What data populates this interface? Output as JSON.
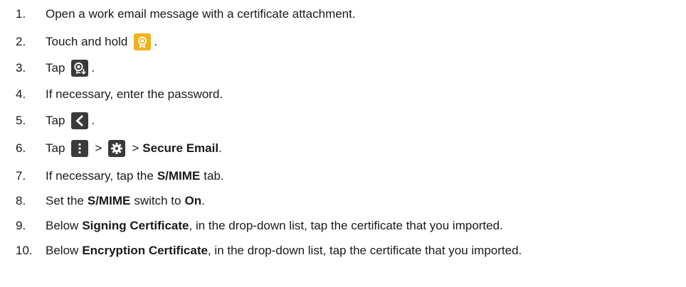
{
  "steps": [
    {
      "num": "1.",
      "text": "Open a work email message with a certificate attachment."
    },
    {
      "num": "2.",
      "pre": "Touch and hold",
      "post": ".",
      "icon": "certificate-icon"
    },
    {
      "num": "3.",
      "pre": "Tap",
      "post": ".",
      "icon": "import-certificate-icon"
    },
    {
      "num": "4.",
      "text": "If necessary, enter the password."
    },
    {
      "num": "5.",
      "pre": "Tap",
      "post": ".",
      "icon": "back-arrow-icon"
    },
    {
      "num": "6.",
      "pre": "Tap",
      "sep1": ">",
      "sep2": ">",
      "bold": "Secure Email",
      "post": ".",
      "icon1": "menu-more-icon",
      "icon2": "settings-gear-icon"
    },
    {
      "num": "7.",
      "pre": "If necessary, tap the",
      "bold": "S/MIME",
      "post": "tab."
    },
    {
      "num": "8.",
      "pre": "Set the",
      "bold": "S/MIME",
      "mid": "switch to",
      "bold2": "On",
      "post": "."
    },
    {
      "num": "9.",
      "pre": "Below",
      "bold": "Signing Certificate",
      "post": ", in the drop-down list, tap the certificate that you imported."
    },
    {
      "num": "10.",
      "pre": "Below",
      "bold": "Encryption Certificate",
      "post": ", in the drop-down list, tap the certificate that you imported."
    }
  ],
  "colors": {
    "cert_icon_bg": "#f0b11b",
    "dark_icon_bg": "#3a3a3a",
    "text": "#1a1a1a"
  }
}
